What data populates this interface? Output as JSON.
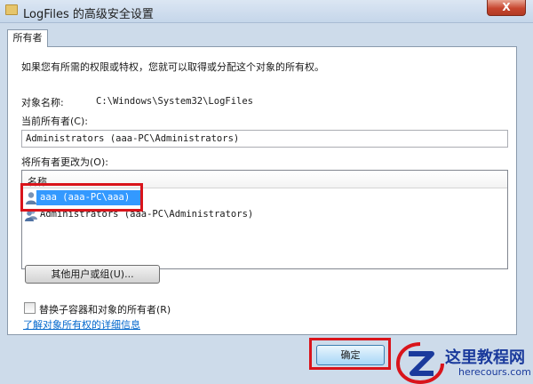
{
  "window": {
    "title": "LogFiles 的高级安全设置",
    "close_label": "X"
  },
  "tabs": [
    {
      "label": "所有者",
      "active": true
    }
  ],
  "owner_tab": {
    "intro": "如果您有所需的权限或特权，您就可以取得或分配这个对象的所有权。",
    "object_name_label": "对象名称:",
    "object_name_value": "C:\\Windows\\System32\\LogFiles",
    "current_owner_label": "当前所有者(C):",
    "current_owner_value": "Administrators (aaa-PC\\Administrators)",
    "change_owner_label": "将所有者更改为(O):",
    "list_header": "名称",
    "owners": [
      {
        "label": "aaa (aaa-PC\\aaa)",
        "selected": true,
        "icon": "user-icon"
      },
      {
        "label": "Administrators (aaa-PC\\Administrators)",
        "selected": false,
        "icon": "group-icon"
      }
    ],
    "other_users_button": "其他用户或组(U)...",
    "replace_checkbox_label": "替换子容器和对象的所有者(R)",
    "replace_checked": false,
    "learn_more_link": "了解对象所有权的详细信息"
  },
  "footer": {
    "ok_button": "确定"
  },
  "watermark": {
    "title": "这里教程网",
    "url": "herecours.com",
    "logo_icon": "z-logo-icon"
  },
  "colors": {
    "highlight_red": "#d9141b",
    "selection_blue": "#3399ff",
    "link_blue": "#0066cc"
  }
}
